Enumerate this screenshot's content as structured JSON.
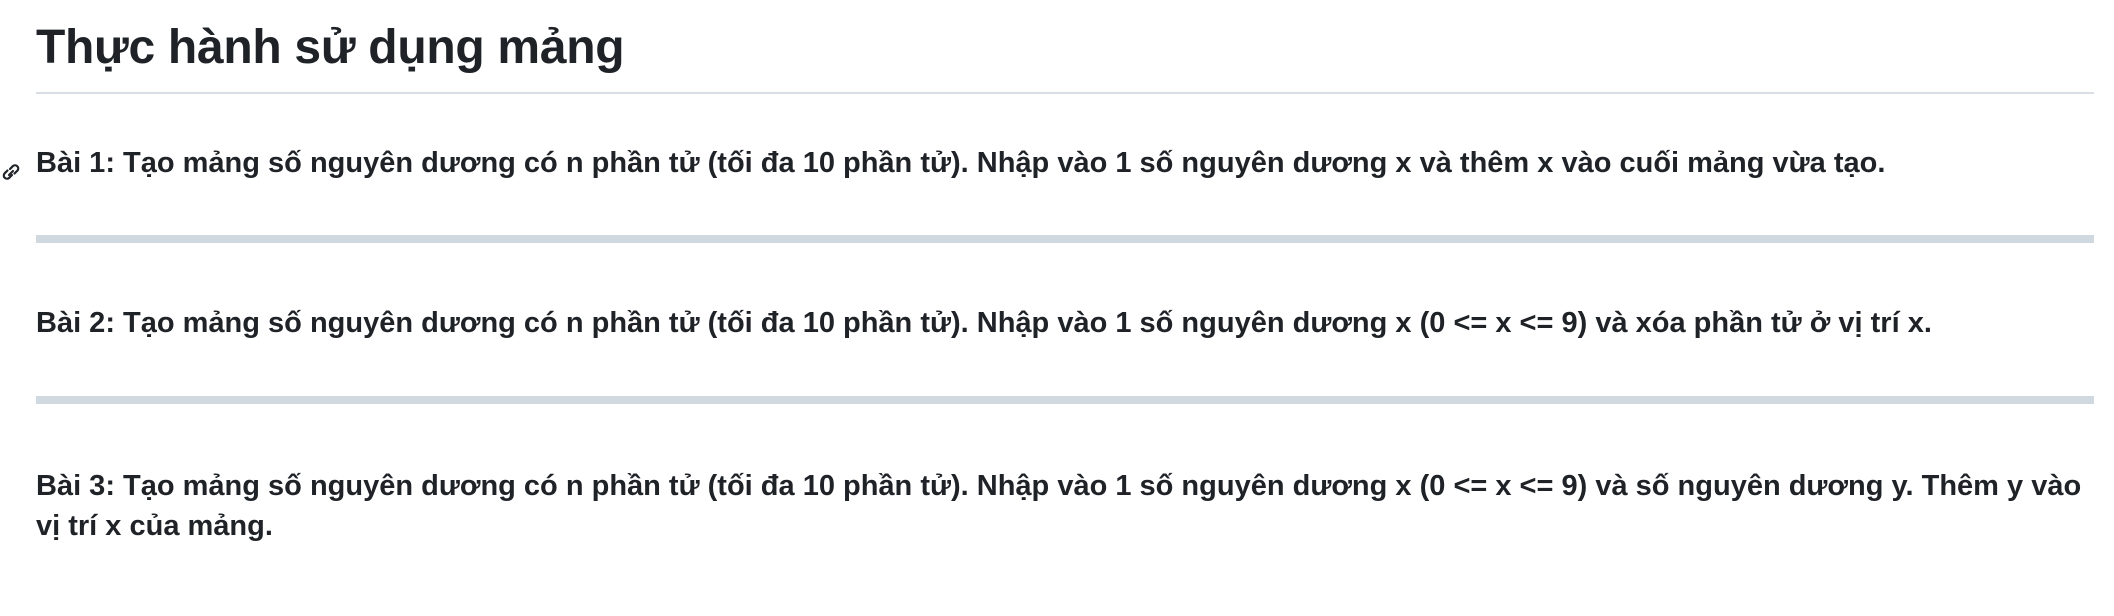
{
  "page": {
    "title": "Thực hành sử dụng mảng"
  },
  "exercises": [
    {
      "text": "Bài 1: Tạo mảng số nguyên dương có n phần tử (tối đa 10 phần tử). Nhập vào 1 số nguyên dương x và thêm x vào cuối mảng vừa tạo."
    },
    {
      "text": "Bài 2: Tạo mảng số nguyên dương có n phần tử (tối đa 10 phần tử). Nhập vào 1 số nguyên dương x (0 <= x <= 9) và xóa phần tử ở vị trí x."
    },
    {
      "text": "Bài 3: Tạo mảng số nguyên dương có n phần tử (tối đa 10 phần tử). Nhập vào 1 số nguyên dương x (0 <= x <= 9) và số nguyên dương y. Thêm y vào vị trí x của mảng."
    }
  ],
  "icons": {
    "heading_anchor": "link-icon"
  },
  "colors": {
    "text": "#1f2328",
    "title_rule": "#d8dee4",
    "section_rule": "#d1d9e0"
  }
}
